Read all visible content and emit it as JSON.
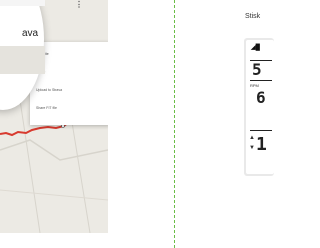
{
  "phone": {
    "magnifier_text": "ava",
    "menu": {
      "items": [
        {
          "label": "Favorite"
        },
        {
          "label": "Share"
        },
        {
          "label": "Upload to Strava"
        },
        {
          "label": "Share FIT file"
        }
      ]
    }
  },
  "device": {
    "instruction": "Stisk",
    "rpm_label": "RPM"
  },
  "colors": {
    "route": "#d83a2e",
    "divider": "#6abd45",
    "map": "#eceae4"
  }
}
